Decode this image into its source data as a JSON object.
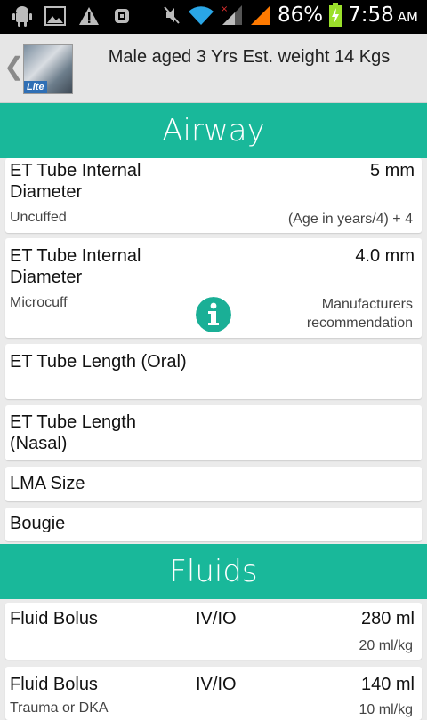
{
  "status_bar": {
    "battery_percent": "86%",
    "time": "7:58",
    "ampm": "AM"
  },
  "header": {
    "logo_badge": "Lite",
    "title": "Male aged 3 Yrs  Est. weight 14 Kgs"
  },
  "sections": {
    "airway": "Airway",
    "fluids": "Fluids"
  },
  "airway_items": [
    {
      "label": "ET Tube Internal Diameter",
      "value": "5 mm",
      "sub": "Uncuffed",
      "note": "(Age in years/4) + 4"
    },
    {
      "label": "ET Tube Internal Diameter",
      "value": "4.0 mm",
      "sub": "Microcuff",
      "note": "Manufacturers recommendation"
    },
    {
      "label": "ET Tube Length (Oral)"
    },
    {
      "label": "ET Tube Length (Nasal)"
    },
    {
      "label": "LMA Size"
    },
    {
      "label": "Bougie"
    }
  ],
  "fluid_items": [
    {
      "label": "Fluid Bolus",
      "route": "IV/IO",
      "value": "280 ml",
      "note": "20 ml/kg"
    },
    {
      "label": "Fluid Bolus",
      "route": "IV/IO",
      "value": "140 ml",
      "sub": "Trauma or DKA",
      "note": "10 ml/kg"
    }
  ],
  "colors": {
    "accent": "#19b89a",
    "background": "#ebebeb",
    "status_orange": "#ff7a00"
  },
  "icons": [
    "android-icon",
    "image-icon",
    "warning-icon",
    "usb-debug-icon",
    "mute-icon",
    "wifi-icon",
    "signal-icon",
    "battery-charging-icon",
    "back-chevron-icon",
    "info-icon"
  ]
}
